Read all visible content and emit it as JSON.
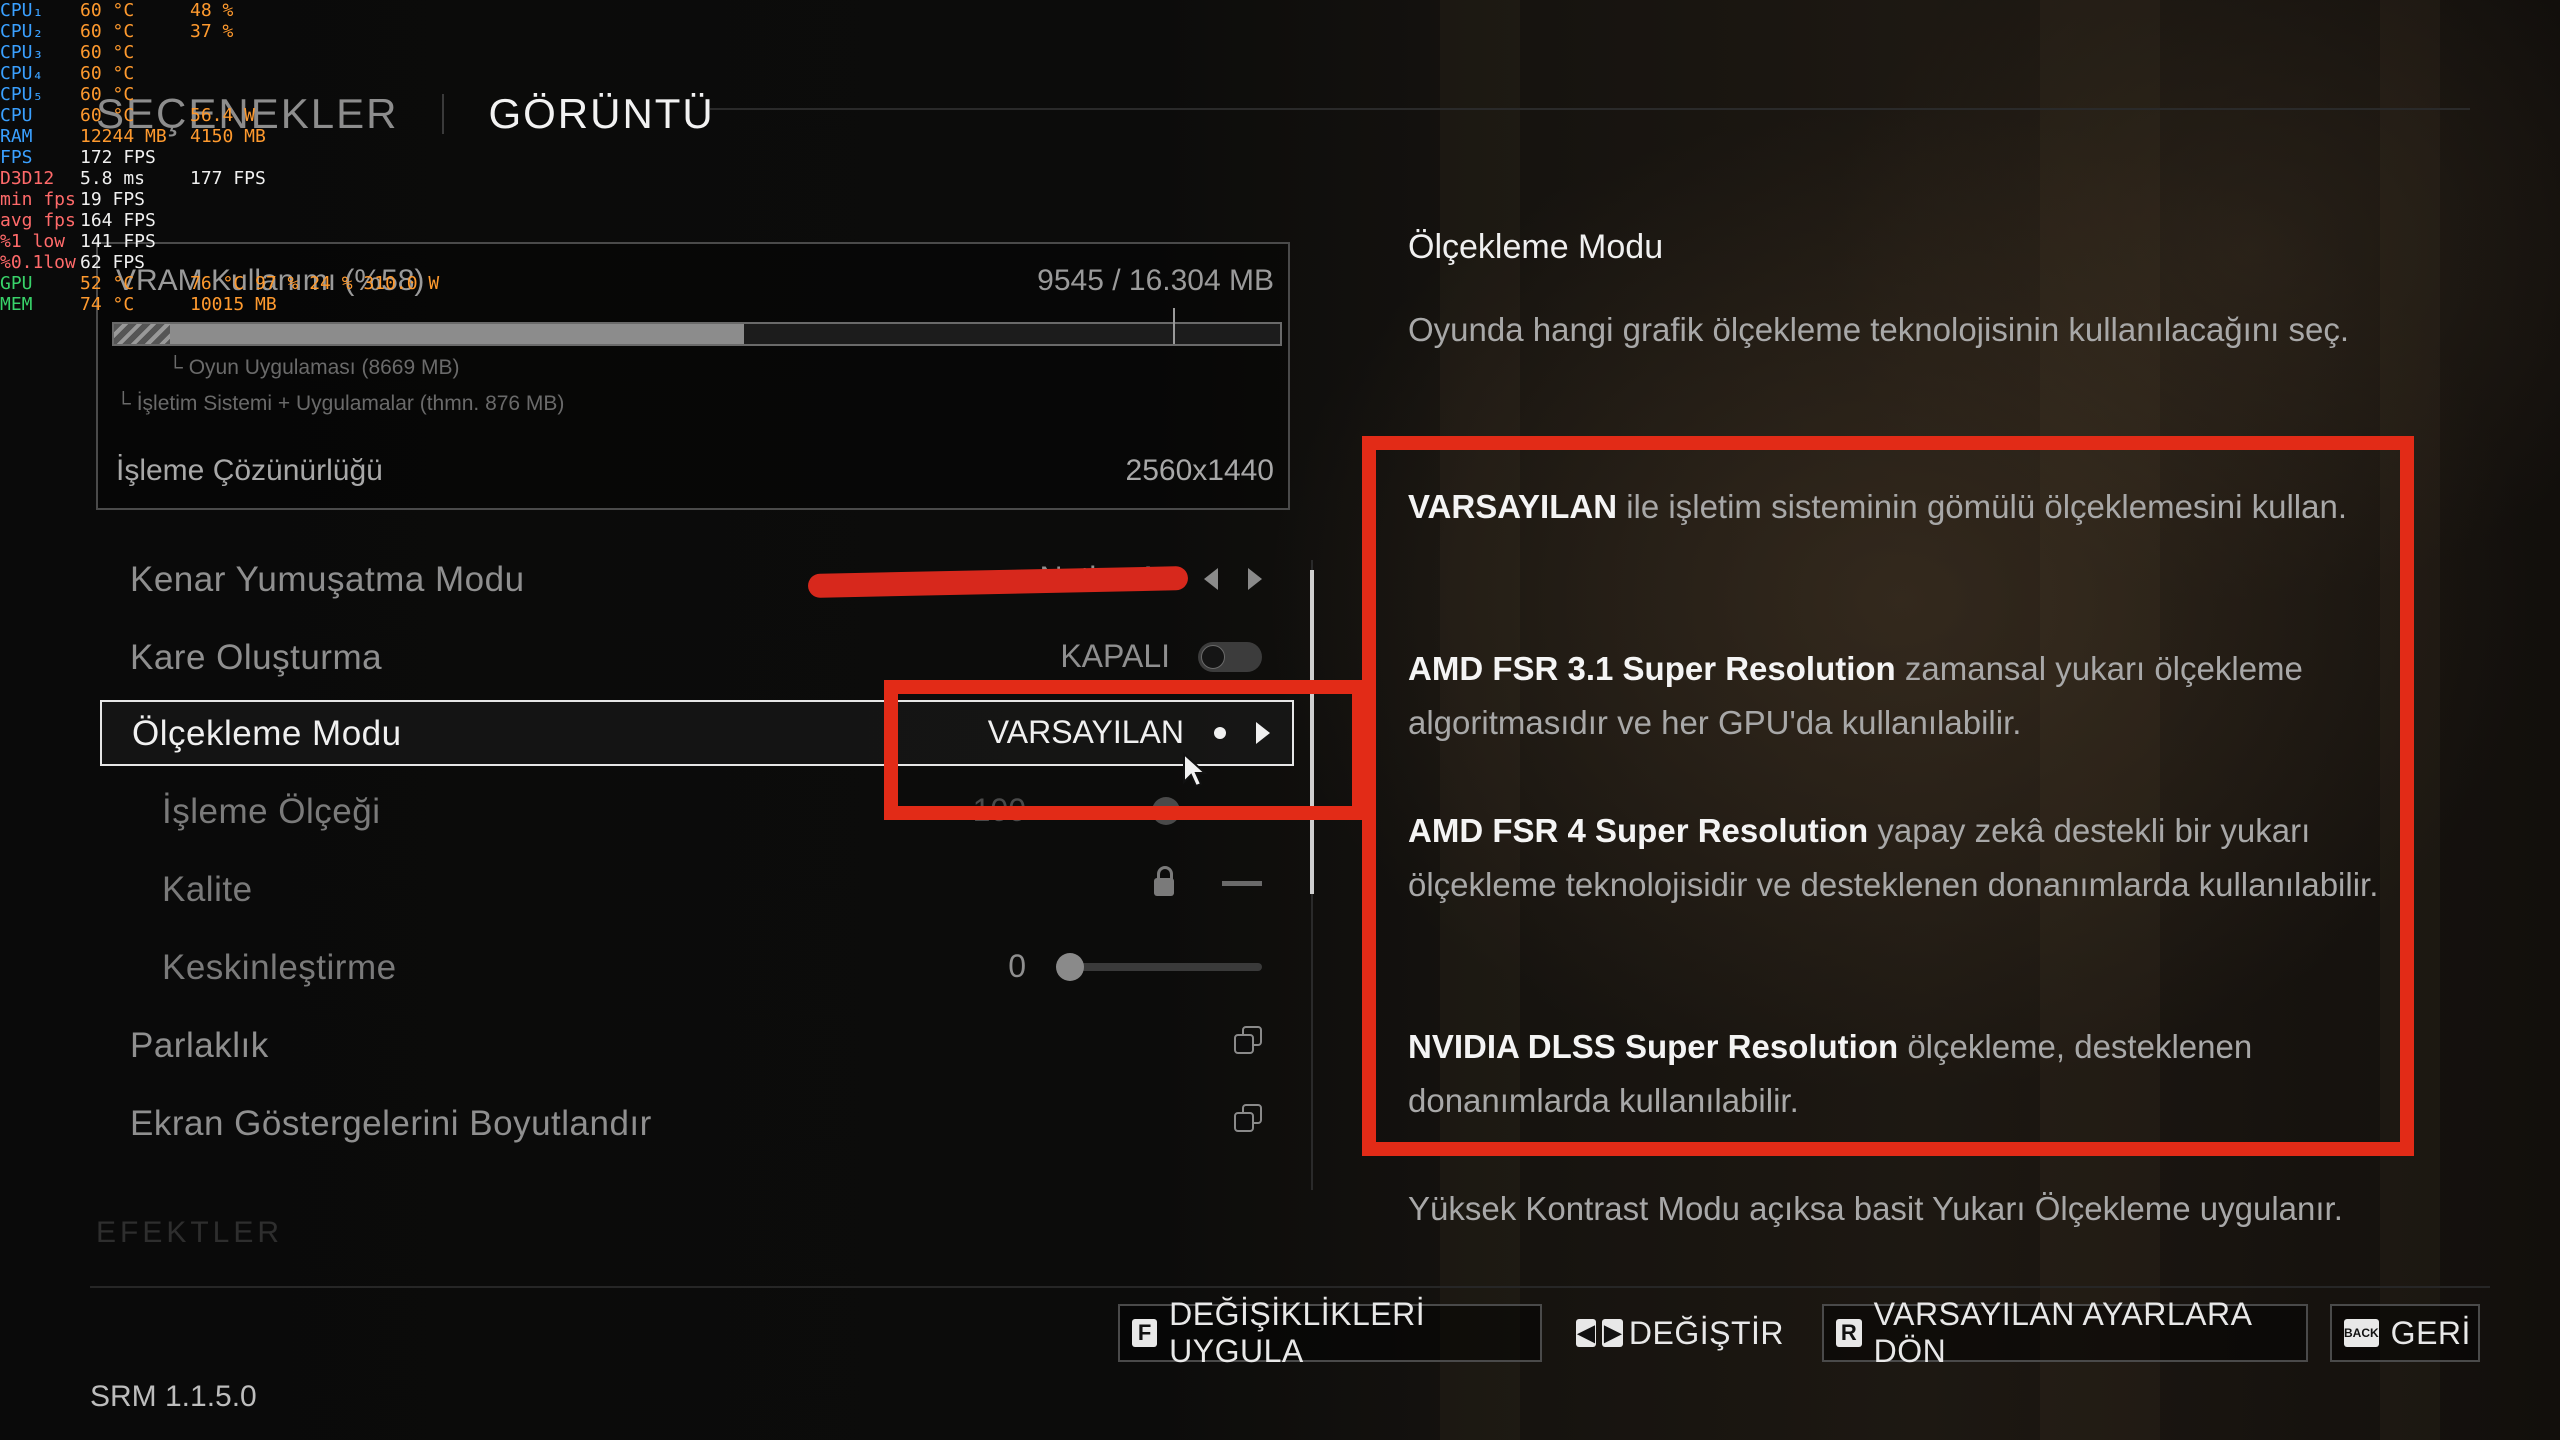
{
  "overlay": {
    "rows": [
      {
        "label": "CPU₁",
        "v1": "60 °C",
        "v2": "48 %"
      },
      {
        "label": "CPU₂",
        "v1": "60 °C",
        "v2": "37 %"
      },
      {
        "label": "CPU₃",
        "v1": "60 °C",
        "v2": ""
      },
      {
        "label": "CPU₄",
        "v1": "60 °C",
        "v2": ""
      },
      {
        "label": "CPU₅",
        "v1": "60 °C",
        "v2": ""
      },
      {
        "label": "CPU",
        "v1": "60 °C",
        "v2": "56.4 W"
      },
      {
        "label": "RAM",
        "v1": "12244 MB",
        "v2": "4150 MB"
      },
      {
        "label": "FPS",
        "v1": "172 FPS",
        "v2": ""
      },
      {
        "label": "D3D12",
        "v1": "5.8 ms",
        "v2": "177 FPS"
      },
      {
        "label": "min fps",
        "v1": "19 FPS",
        "v2": ""
      },
      {
        "label": "avg fps",
        "v1": "164 FPS",
        "v2": ""
      },
      {
        "label": "%1 low",
        "v1": "141 FPS",
        "v2": ""
      },
      {
        "label": "%0.1low",
        "v1": "62 FPS",
        "v2": ""
      },
      {
        "label": "GPU",
        "v1": "52 °C",
        "v2": "76 °C  97 %  24 %  310.0 W"
      },
      {
        "label": "MEM",
        "v1": "74 °C",
        "v2": "10015 MB"
      }
    ]
  },
  "header": {
    "breadcrumb": "SEÇENEKLER",
    "title": "GÖRÜNTÜ"
  },
  "vram": {
    "label": "VRAM Kullanımı (%58)",
    "value": "9545 / 16.304 MB",
    "usage_fraction": 0.54,
    "sub_game": "Oyun Uygulaması (8669 MB)",
    "sub_os": "İşletim Sistemi + Uygulamalar (thmn. 876 MB)",
    "resolution_label": "İşleme Çözünürlüğü",
    "resolution_value": "2560x1440"
  },
  "settings": {
    "antialias": {
      "label": "Kenar Yumuşatma Modu",
      "value": "... Native AA"
    },
    "frame_gen": {
      "label": "Kare Oluşturma",
      "value": "KAPALI"
    },
    "scaling_mode": {
      "label": "Ölçekleme Modu",
      "value": "VARSAYILAN"
    },
    "render_scale": {
      "label": "İşleme Ölçeği",
      "value": "100"
    },
    "quality": {
      "label": "Kalite"
    },
    "sharpening": {
      "label": "Keskinleştirme",
      "value": "0"
    },
    "brightness": {
      "label": "Parlaklık"
    },
    "hud_scale": {
      "label": "Ekran Göstergelerini Boyutlandır"
    },
    "next_section": "EFEKTLER"
  },
  "description": {
    "title": "Ölçekleme Modu",
    "intro": "Oyunda hangi grafik ölçekleme teknolojisinin kullanılacağını seç.",
    "items": [
      {
        "bold": "VARSAYILAN",
        "rest": " ile işletim sisteminin gömülü ölçeklemesini kullan."
      },
      {
        "bold": "AMD FSR 3.1 Super Resolution",
        "rest": " zamansal yukarı ölçekleme algoritmasıdır ve her GPU'da kullanılabilir."
      },
      {
        "bold": "AMD FSR 4 Super Resolution",
        "rest": " yapay zekâ destekli bir yukarı ölçekleme teknolojisidir ve desteklenen donanımlarda kullanılabilir."
      },
      {
        "bold": "NVIDIA DLSS Super Resolution",
        "rest": " ölçekleme, desteklenen donanımlarda kullanılabilir."
      }
    ],
    "note": "Yüksek Kontrast Modu açıksa basit Yukarı Ölçekleme uygulanır."
  },
  "footer": {
    "apply": {
      "key": "F",
      "label": "DEĞİŞİKLİKLERİ UYGULA"
    },
    "change": {
      "label": "DEĞİŞTİR"
    },
    "reset": {
      "key": "R",
      "label": "VARSAYILAN AYARLARA DÖN"
    },
    "back": {
      "key": "BACK",
      "label": "GERİ"
    },
    "version": "SRM 1.1.5.0"
  },
  "colors": {
    "annotation_red": "#e22b17",
    "accent_white": "#f0f0f0"
  }
}
